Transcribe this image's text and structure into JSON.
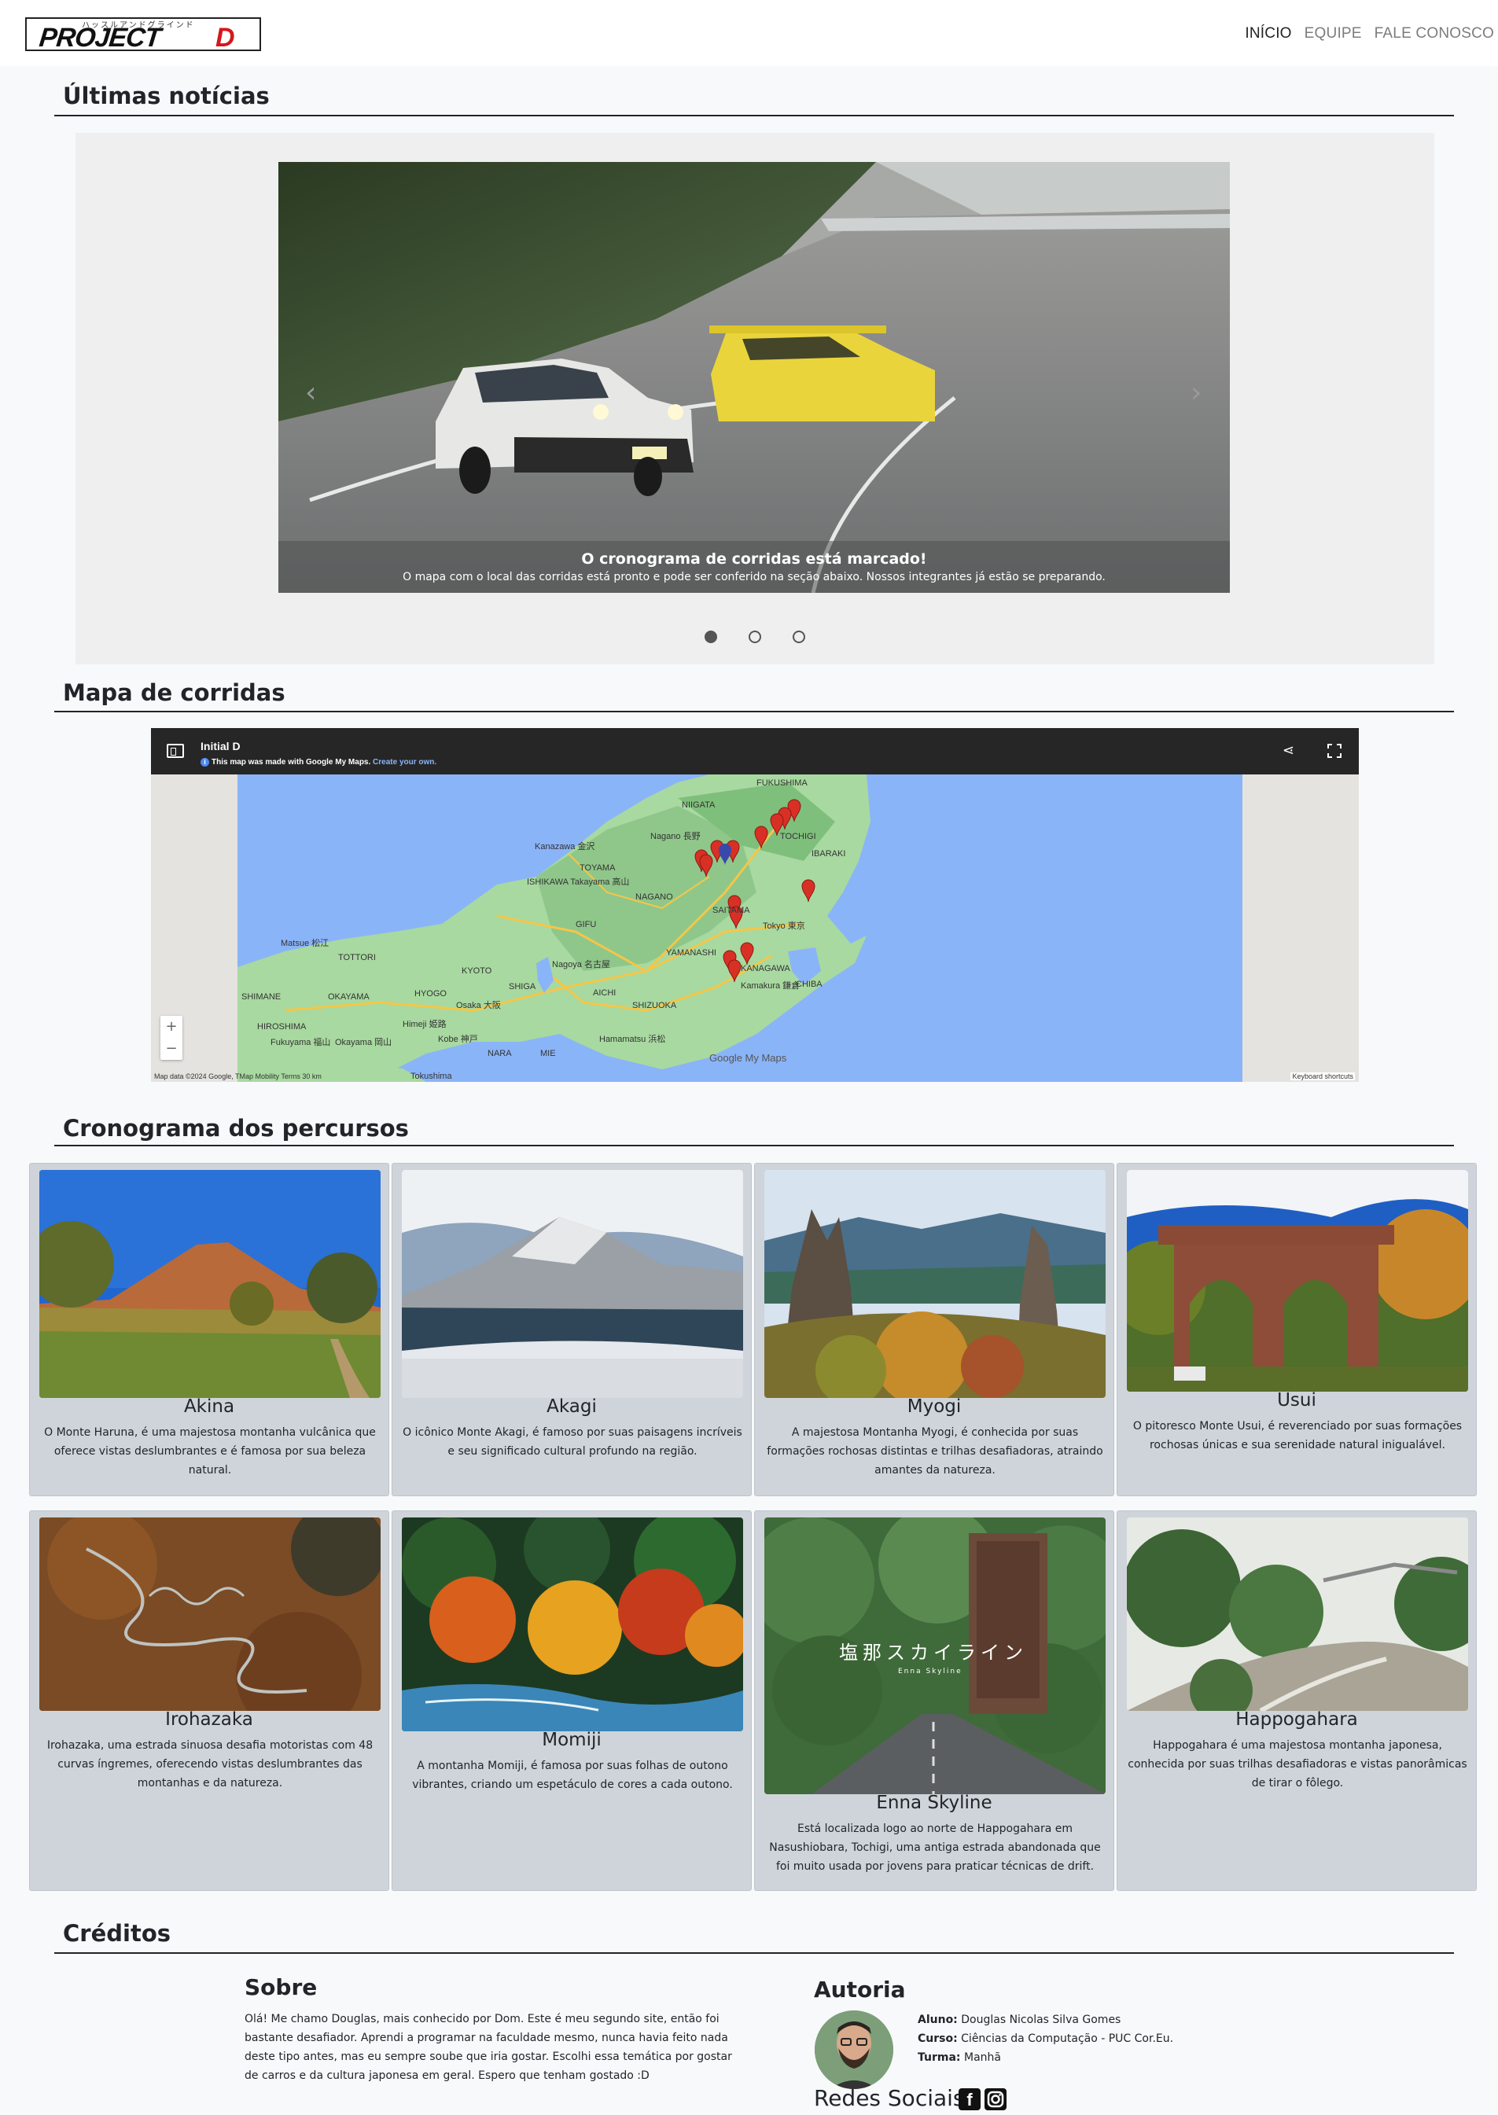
{
  "navbar": {
    "logo_text": "PROJECT",
    "logo_letter": "D",
    "logo_subtitle": "ハッスルアンドグラインド",
    "links": [
      {
        "label": "INÍCIO"
      },
      {
        "label": "EQUIPE"
      },
      {
        "label": "FALE CONOSCO"
      }
    ]
  },
  "news": {
    "title": "Últimas notícias",
    "caption_title": "O cronograma de corridas está marcado!",
    "caption_text": "O mapa com o local das corridas está pronto e pode ser conferido na seção abaixo. Nossos integrantes já estão se preparando.",
    "prev_icon": "chevron-left-icon",
    "next_icon": "chevron-right-icon",
    "slides_count": 3,
    "active_slide": 1
  },
  "map_section": {
    "title": "Mapa de corridas",
    "map_title": "Initial D",
    "map_notice": "This map was made with Google My Maps.",
    "map_notice_link": "Create your own.",
    "footer": "Map data ©2024 Google, TMap Mobility   Terms   30 km",
    "keyboard": "Keyboard shortcuts",
    "brand": "Google My Maps",
    "labels": [
      {
        "text": "FUKUSHIMA"
      },
      {
        "text": "NIIGATA"
      },
      {
        "text": "TOCHIGI"
      },
      {
        "text": "IBARAKI"
      },
      {
        "text": "Kanazawa 金沢"
      },
      {
        "text": "Nagano 長野"
      },
      {
        "text": "TOYAMA"
      },
      {
        "text": "ISHIKAWA Takayama 高山"
      },
      {
        "text": "NAGANO"
      },
      {
        "text": "GIFU"
      },
      {
        "text": "SAITAMA"
      },
      {
        "text": "Tokyo 東京"
      },
      {
        "text": "Matsue 松江"
      },
      {
        "text": "TOTTORI"
      },
      {
        "text": "KYOTO"
      },
      {
        "text": "Nagoya 名古屋"
      },
      {
        "text": "YAMANASHI"
      },
      {
        "text": "KANAGAWA"
      },
      {
        "text": "CHIBA"
      },
      {
        "text": "Kamakura 鎌倉"
      },
      {
        "text": "SHIMANE"
      },
      {
        "text": "OKAYAMA"
      },
      {
        "text": "HYOGO"
      },
      {
        "text": "SHIGA"
      },
      {
        "text": "AICHI"
      },
      {
        "text": "SHIZUOKA"
      },
      {
        "text": "Osaka 大阪"
      },
      {
        "text": "HIROSHIMA"
      },
      {
        "text": "Fukuyama 福山"
      },
      {
        "text": "Okayama 岡山"
      },
      {
        "text": "Himeji 姫路"
      },
      {
        "text": "Kobe 神戸"
      },
      {
        "text": "NARA"
      },
      {
        "text": "MIE"
      },
      {
        "text": "Hamamatsu 浜松"
      },
      {
        "text": "Tokushima"
      }
    ]
  },
  "schedule": {
    "title": "Cronograma dos percursos",
    "routes": [
      {
        "name": "Akina",
        "description": "O Monte Haruna, é uma majestosa montanha vulcânica que oferece vistas deslumbrantes e é famosa por sua beleza natural."
      },
      {
        "name": "Akagi",
        "description": "O icônico Monte Akagi, é famoso por suas paisagens incríveis e seu significado cultural profundo na região."
      },
      {
        "name": "Myogi",
        "description": "A majestosa Montanha Myogi, é conhecida por suas formações rochosas distintas e trilhas desafiadoras, atraindo amantes da natureza."
      },
      {
        "name": "Usui",
        "description": "O pitoresco Monte Usui, é reverenciado por suas formações rochosas únicas e sua serenidade natural inigualável."
      },
      {
        "name": "Irohazaka",
        "description": "Irohazaka, uma estrada sinuosa desafia motoristas com 48 curvas íngremes, oferecendo vistas deslumbrantes das montanhas e da natureza."
      },
      {
        "name": "Momiji",
        "description": "A montanha Momiji, é famosa por suas folhas de outono vibrantes, criando um espetáculo de cores a cada outono."
      },
      {
        "name": "Enna Skyline",
        "description": "Está localizada logo ao norte de Happogahara em Nasushiobara, Tochigi, uma antiga estrada abandonada que foi muito usada por jovens para praticar técnicas de drift."
      },
      {
        "name": "Happogahara",
        "description": "Happogahara é uma majestosa montanha japonesa, conhecida por suas trilhas desafiadoras e vistas panorâmicas de tirar o fôlego."
      }
    ],
    "sign_text": "塩那スカイライン",
    "sign_sub": "Enna Skyline"
  },
  "credits": {
    "title": "Créditos",
    "about_title": "Sobre",
    "about_text": "Olá! Me chamo Douglas, mais conhecido por Dom. Este é meu segundo site, então foi bastante desafiador. Aprendi a programar na faculdade mesmo, nunca havia feito nada deste tipo antes, mas eu sempre soube que iria gostar. Escolhi essa temática por gostar de carros e da cultura japonesa em geral. Espero que tenham gostado :D",
    "author_title": "Autoria",
    "student_label": "Aluno:",
    "student_value": "Douglas Nicolas Silva Gomes",
    "course_label": "Curso:",
    "course_value": "Ciências da Computação - PUC Cor.Eu.",
    "class_label": "Turma:",
    "class_value": "Manhã",
    "social_label": "Redes Sociais:",
    "social_icons": [
      "facebook-icon",
      "instagram-icon"
    ]
  }
}
